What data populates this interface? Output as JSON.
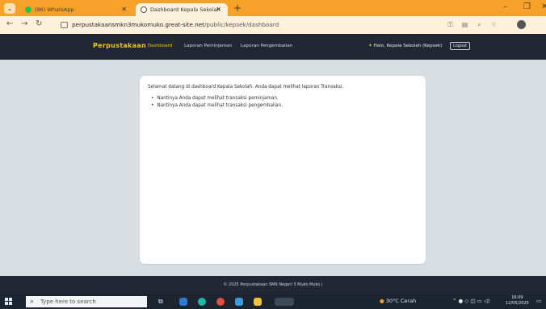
{
  "browser": {
    "tabs": [
      {
        "label": "(96) WhatsApp",
        "favicon": "whatsapp-icon"
      },
      {
        "label": "Dashboard Kepala Sekolah",
        "favicon": "globe-icon"
      }
    ],
    "new_tab": "+",
    "url_host": "perpustakaansmkn3mukomuko.great-site.net",
    "url_path": "/public/kepsek/dashboard"
  },
  "navbar": {
    "brand": "Perpustakaan",
    "links": [
      "Dashboard",
      "Laporan Peminjaman",
      "Laporan Pengembalian"
    ],
    "greeting": "Halo, Kepala Sekolah (Kepsek)",
    "logout": "Logout"
  },
  "main": {
    "welcome": "Selamat datang di dashboard Kepala Sekolah. Anda dapat melihat laporan Transaksi.",
    "bullets": [
      "Nantinya Anda dapat melihat transaksi peminjaman.",
      "Nantinya Anda dapat melihat transaksi pengembalian."
    ]
  },
  "footer": {
    "text": "© 2025 Perpustakaan SMK Negeri 3 Muko Muko |"
  },
  "taskbar": {
    "search_placeholder": "Type here to search",
    "weather": "30°C Cerah",
    "time": "16:09",
    "date": "12/05/2025"
  },
  "colors": {
    "tab_strip": "#f5a12a",
    "navbar_bg": "#212833",
    "brand": "#f5c518",
    "page_bg": "#d8dde2"
  }
}
